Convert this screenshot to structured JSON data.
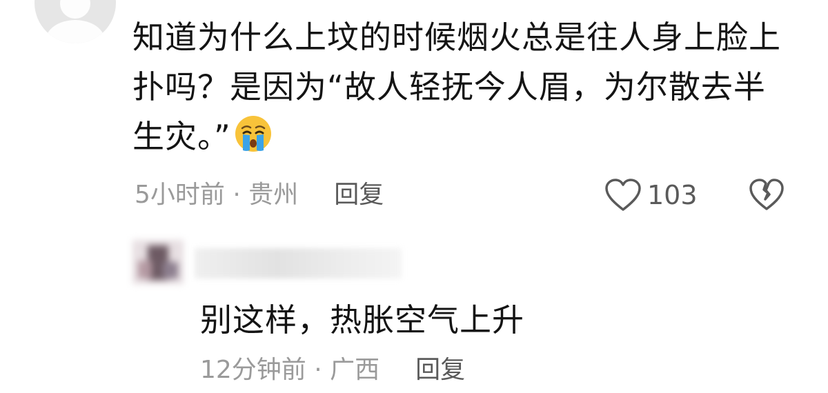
{
  "comment": {
    "text": "知道为什么上坟的时候烟火总是往人身上脸上扑吗？是因为“故人轻抚今人眉，为尔散去半生灾。”",
    "emoji": "loudly-crying-face",
    "time": "5小时前",
    "separator": " · ",
    "location": "贵州",
    "reply_label": "回复",
    "like_count": "103"
  },
  "reply": {
    "text": "别这样，热胀空气上升",
    "time": "12分钟前",
    "separator": " · ",
    "location": "广西",
    "reply_label": "回复"
  },
  "colors": {
    "text_primary": "#141414",
    "text_secondary": "#9a9a9a",
    "text_action": "#5a5a5a",
    "emoji_face": "#f8c33a",
    "emoji_tears": "#3ba3e8"
  }
}
